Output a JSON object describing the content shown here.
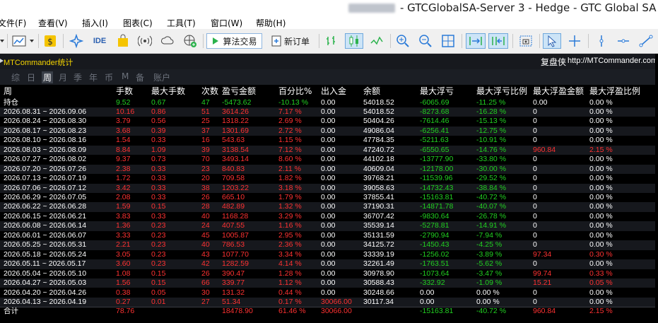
{
  "window": {
    "title": "- GTCGlobalSA-Server 3 - Hedge - GTC Global SA ("
  },
  "menu": [
    "文件(F)",
    "查看(V)",
    "插入(I)",
    "图表(C)",
    "工具(T)",
    "窗口(W)",
    "帮助(H)"
  ],
  "toolbar": {
    "ide_label": "IDE",
    "algo_label": "算法交易",
    "new_order_label": "新订单"
  },
  "chart": {
    "name": "MTCommander统计",
    "right_title": "复盘侠",
    "right_url": "http://MTCommander.com"
  },
  "period_tabs": [
    "综",
    "日",
    "周",
    "月",
    "季",
    "年",
    "币",
    "M",
    "备",
    "账户"
  ],
  "active_period_tab": "周",
  "table": {
    "headers": [
      "周",
      "手数",
      "最大手数",
      "次数",
      "盈亏金额",
      "百分比%",
      "出入金",
      "余额",
      "最大浮亏",
      "最大浮亏比例",
      "最大浮盈金额",
      "最大浮盈比例"
    ],
    "rows": [
      [
        "持仓",
        "9.52",
        "0.67",
        "47",
        "-5473.62",
        "-10.13 %",
        "0.00",
        "54018.52",
        "-6065.69",
        "-11.25 %",
        "0.00",
        "0.00 %"
      ],
      [
        "2026.08.31 ~ 2026.09.06",
        "10.16",
        "0.86",
        "51",
        "3614.26",
        "7.17 %",
        "0.00",
        "54018.52",
        "-8273.68",
        "-16.28 %",
        "0",
        "0.00 %"
      ],
      [
        "2026.08.24 ~ 2026.08.30",
        "3.79",
        "0.56",
        "25",
        "1318.22",
        "2.69 %",
        "0.00",
        "50404.26",
        "-7614.46",
        "-15.13 %",
        "0",
        "0.00 %"
      ],
      [
        "2026.08.17 ~ 2026.08.23",
        "3.68",
        "0.39",
        "37",
        "1301.69",
        "2.72 %",
        "0.00",
        "49086.04",
        "-6256.41",
        "-12.75 %",
        "0",
        "0.00 %"
      ],
      [
        "2026.08.10 ~ 2026.08.16",
        "1.54",
        "0.33",
        "16",
        "543.63",
        "1.15 %",
        "0.00",
        "47784.35",
        "-5211.63",
        "-10.91 %",
        "0",
        "0.00 %"
      ],
      [
        "2026.08.03 ~ 2026.08.09",
        "8.84",
        "1.09",
        "39",
        "3138.54",
        "7.12 %",
        "0.00",
        "47240.72",
        "-6550.65",
        "-14.76 %",
        "960.84",
        "2.15 %"
      ],
      [
        "2026.07.27 ~ 2026.08.02",
        "9.37",
        "0.73",
        "70",
        "3493.14",
        "8.60 %",
        "0.00",
        "44102.18",
        "-13777.90",
        "-33.80 %",
        "0",
        "0.00 %"
      ],
      [
        "2026.07.20 ~ 2026.07.26",
        "2.38",
        "0.33",
        "23",
        "840.83",
        "2.11 %",
        "0.00",
        "40609.04",
        "-12178.00",
        "-30.00 %",
        "0",
        "0.00 %"
      ],
      [
        "2026.07.13 ~ 2026.07.19",
        "1.72",
        "0.33",
        "20",
        "709.58",
        "1.82 %",
        "0.00",
        "39768.21",
        "-11539.96",
        "-29.52 %",
        "0",
        "0.00 %"
      ],
      [
        "2026.07.06 ~ 2026.07.12",
        "3.42",
        "0.33",
        "38",
        "1203.22",
        "3.18 %",
        "0.00",
        "39058.63",
        "-14732.43",
        "-38.84 %",
        "0",
        "0.00 %"
      ],
      [
        "2026.06.29 ~ 2026.07.05",
        "2.08",
        "0.33",
        "26",
        "665.10",
        "1.79 %",
        "0.00",
        "37855.41",
        "-15163.81",
        "-40.72 %",
        "0",
        "0.00 %"
      ],
      [
        "2026.06.22 ~ 2026.06.28",
        "1.59",
        "0.15",
        "28",
        "482.89",
        "1.32 %",
        "0.00",
        "37190.31",
        "-14871.78",
        "-40.07 %",
        "0",
        "0.00 %"
      ],
      [
        "2026.06.15 ~ 2026.06.21",
        "3.83",
        "0.33",
        "40",
        "1168.28",
        "3.29 %",
        "0.00",
        "36707.42",
        "-9830.64",
        "-26.78 %",
        "0",
        "0.00 %"
      ],
      [
        "2026.06.08 ~ 2026.06.14",
        "1.36",
        "0.23",
        "24",
        "407.55",
        "1.16 %",
        "0.00",
        "35539.14",
        "-5278.81",
        "-14.91 %",
        "0",
        "0.00 %"
      ],
      [
        "2026.06.01 ~ 2026.06.07",
        "3.33",
        "0.23",
        "45",
        "1005.87",
        "2.95 %",
        "0.00",
        "35131.59",
        "-2790.94",
        "-7.94 %",
        "0",
        "0.00 %"
      ],
      [
        "2026.05.25 ~ 2026.05.31",
        "2.21",
        "0.23",
        "40",
        "786.53",
        "2.36 %",
        "0.00",
        "34125.72",
        "-1450.43",
        "-4.25 %",
        "0",
        "0.00 %"
      ],
      [
        "2026.05.18 ~ 2026.05.24",
        "3.05",
        "0.23",
        "43",
        "1077.70",
        "3.34 %",
        "0.00",
        "33339.19",
        "-1256.02",
        "-3.89 %",
        "97.34",
        "0.30 %"
      ],
      [
        "2026.05.11 ~ 2026.05.17",
        "3.60",
        "0.23",
        "42",
        "1282.59",
        "4.14 %",
        "0.00",
        "32261.49",
        "-1763.51",
        "-5.62 %",
        "0",
        "0.00 %"
      ],
      [
        "2026.05.04 ~ 2026.05.10",
        "1.08",
        "0.15",
        "26",
        "390.47",
        "1.28 %",
        "0.00",
        "30978.90",
        "-1073.64",
        "-3.47 %",
        "99.74",
        "0.33 %"
      ],
      [
        "2026.04.27 ~ 2026.05.03",
        "1.56",
        "0.15",
        "66",
        "339.77",
        "1.12 %",
        "0.00",
        "30588.43",
        "-332.92",
        "-1.09 %",
        "15.21",
        "0.05 %"
      ],
      [
        "2026.04.20 ~ 2026.04.26",
        "0.38",
        "0.05",
        "30",
        "131.32",
        "0.44 %",
        "0.00",
        "30248.66",
        "0.00",
        "0.00 %",
        "0",
        "0.00 %"
      ],
      [
        "2026.04.13 ~ 2026.04.19",
        "0.27",
        "0.01",
        "27",
        "51.34",
        "0.17 %",
        "30066.00",
        "30117.34",
        "0.00",
        "0.00 %",
        "0",
        "0.00 %"
      ],
      [
        "合计",
        "78.76",
        "",
        "",
        "18478.90",
        "61.46 %",
        "30066.00",
        "",
        "-15163.81",
        "-40.72 %",
        "960.84",
        "2.15 %"
      ]
    ]
  },
  "colors": {
    "positive": "#ff3232",
    "negative": "#21d121",
    "neutral": "#ffffff",
    "title": "#f5d400"
  }
}
